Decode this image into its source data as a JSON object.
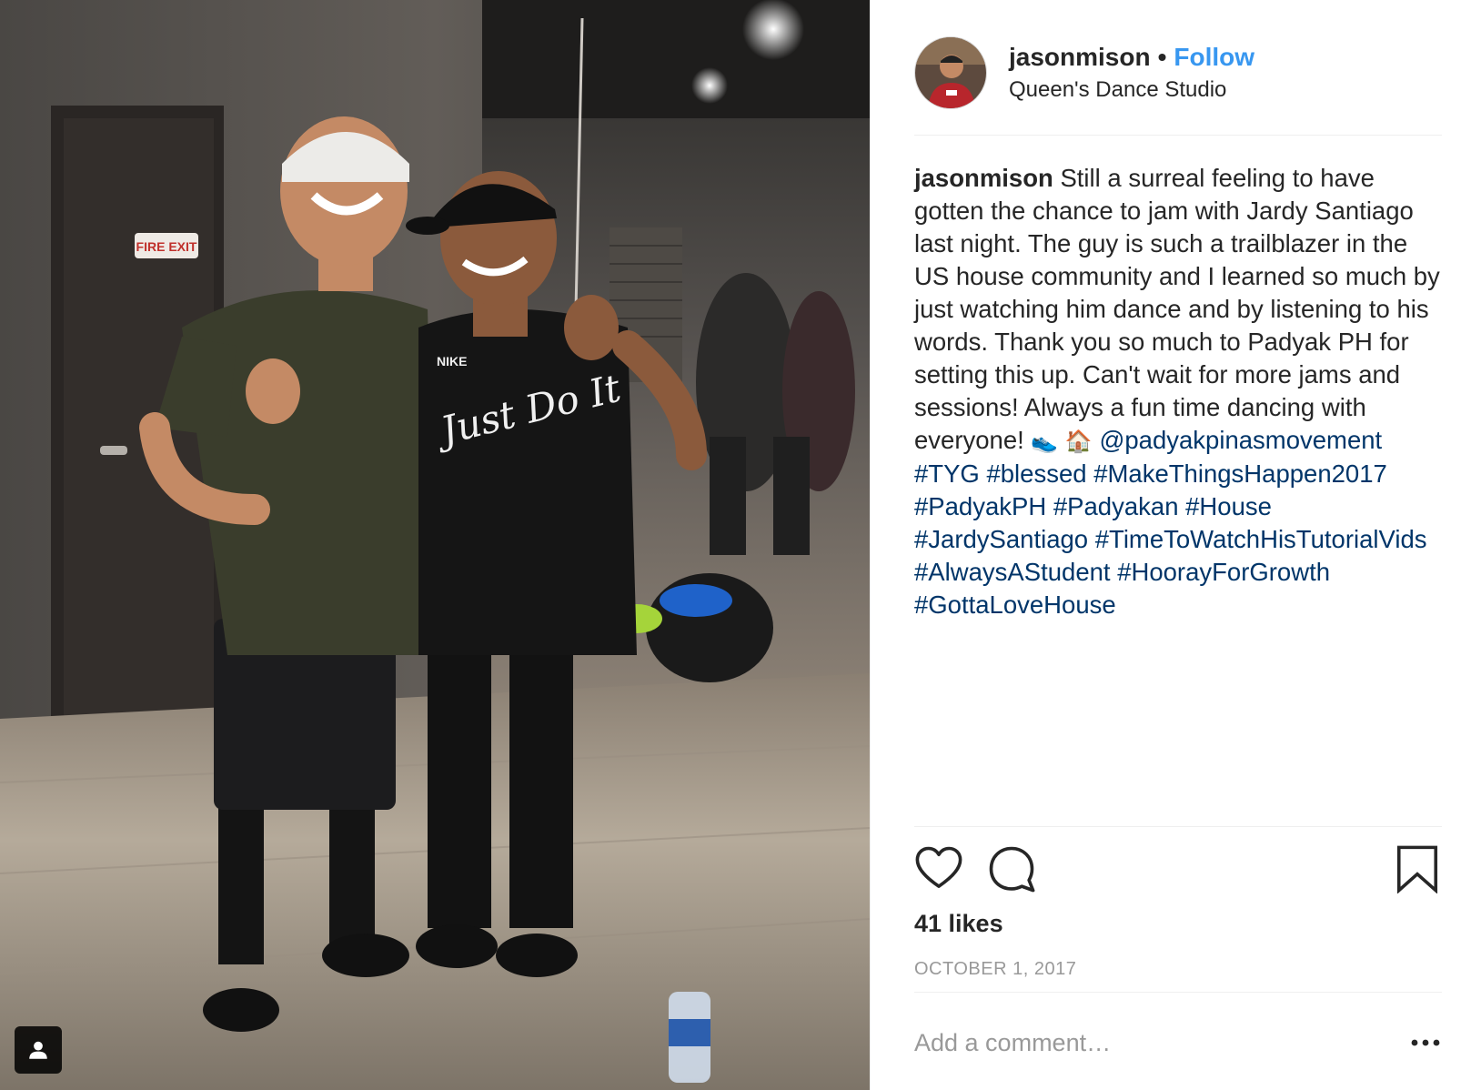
{
  "post": {
    "username": "jasonmison",
    "separator": "•",
    "follow_label": "Follow",
    "location": "Queen's Dance Studio",
    "caption": {
      "username": "jasonmison",
      "text": "Still a surreal feeling to have gotten the chance to jam with Jardy Santiago last night. The guy is such a trailblazer in the US house community and I learned so much by just watching him dance and by listening to his words. Thank you so much to Padyak PH for setting this up. Can't wait for more jams and sessions! Always a fun time dancing with everyone!",
      "emojis": "👟 🏠",
      "tags": [
        "@padyakpinasmovement",
        "#TYG",
        "#blessed",
        "#MakeThingsHappen2017",
        "#PadyakPH",
        "#Padyakan",
        "#House",
        "#JardySantiago",
        "#TimeToWatchHisTutorialVids",
        "#AlwaysAStudent",
        "#HoorayForGrowth",
        "#GottaLoveHouse"
      ]
    },
    "likes": "41 likes",
    "date": "OCTOBER 1, 2017",
    "comment_placeholder": "Add a comment…"
  },
  "photo": {
    "sign_text": "FIRE EXIT",
    "shirt_text": "Just Do It",
    "shirt_brand": "NIKE"
  },
  "icons": {
    "heart": "heart-icon",
    "comment": "comment-icon",
    "bookmark": "bookmark-icon",
    "more": "more-options-icon",
    "tag": "user-tag-icon"
  },
  "colors": {
    "link": "#3897f0",
    "hashtag": "#003569",
    "muted": "#999999",
    "text": "#262626"
  }
}
